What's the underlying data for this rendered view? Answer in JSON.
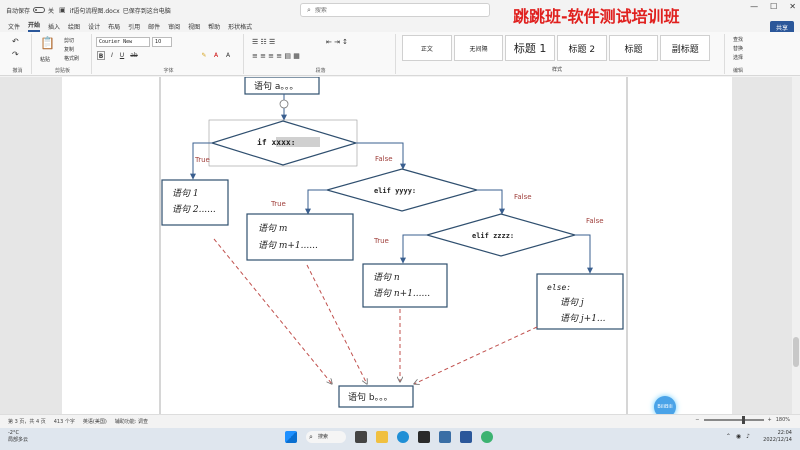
{
  "titlebar": {
    "autosave_label": "自动保存",
    "autosave_state": "关",
    "filename": "if语句流程图.docx",
    "save_status": "已保存到这台电脑",
    "search_placeholder": "搜索",
    "banner": "跳跳班-软件测试培训班"
  },
  "menu": {
    "tabs": [
      "文件",
      "开始",
      "插入",
      "绘图",
      "设计",
      "布局",
      "引用",
      "邮件",
      "审阅",
      "视图",
      "帮助",
      "形状格式"
    ],
    "share": "共享"
  },
  "ribbon": {
    "undo_label": "撤消",
    "paste_label": "粘贴",
    "cut": "剪切",
    "copy": "复制",
    "format_painter": "格式刷",
    "clipboard_label": "剪贴板",
    "font_name": "Courier New",
    "font_size": "10",
    "font_label": "字体",
    "paragraph_label": "段落",
    "styles_label": "样式",
    "styles": [
      "正文",
      "无间隔",
      "标题 1",
      "标题 2",
      "标题",
      "副标题"
    ],
    "find": "查找",
    "replace": "替换",
    "select": "选择",
    "edit_label": "编辑"
  },
  "flowchart": {
    "top_box": "语句 a。。。",
    "if_cond": "if xxxx:",
    "if_true": "True",
    "if_false": "False",
    "branch1_line1": "语句 1",
    "branch1_line2": "语句 2......",
    "elif1_cond": "elif yyyy:",
    "elif1_true": "True",
    "elif1_false": "False",
    "branch2_line1": "语句 m",
    "branch2_line2": "语句 m+1......",
    "elif2_cond": "elif zzzz:",
    "elif2_true": "True",
    "elif2_false": "False",
    "branch3_line1": "语句 n",
    "branch3_line2": "语句 n+1......",
    "else_label": "else:",
    "branch4_line1": "语句 j",
    "branch4_line2": "语句 j+1...",
    "bottom_box": "语句 b。。。",
    "colors": {
      "box_border": "#2f4f6f",
      "arrow_solid": "#3a5f8f",
      "arrow_dashed": "#c0504d",
      "label": "#a0403c"
    }
  },
  "status": {
    "page": "第 3 页，共 4 页",
    "words": "413 个字",
    "lang": "英语(美国)",
    "accessibility": "辅助功能: 调查",
    "zoom": "180%"
  },
  "taskbar": {
    "weather_temp": "-2°C",
    "weather_desc": "局部多云",
    "search_label": "搜索",
    "time": "22:04",
    "date": "2022/12/14"
  },
  "bubble_label": "BiliBili"
}
